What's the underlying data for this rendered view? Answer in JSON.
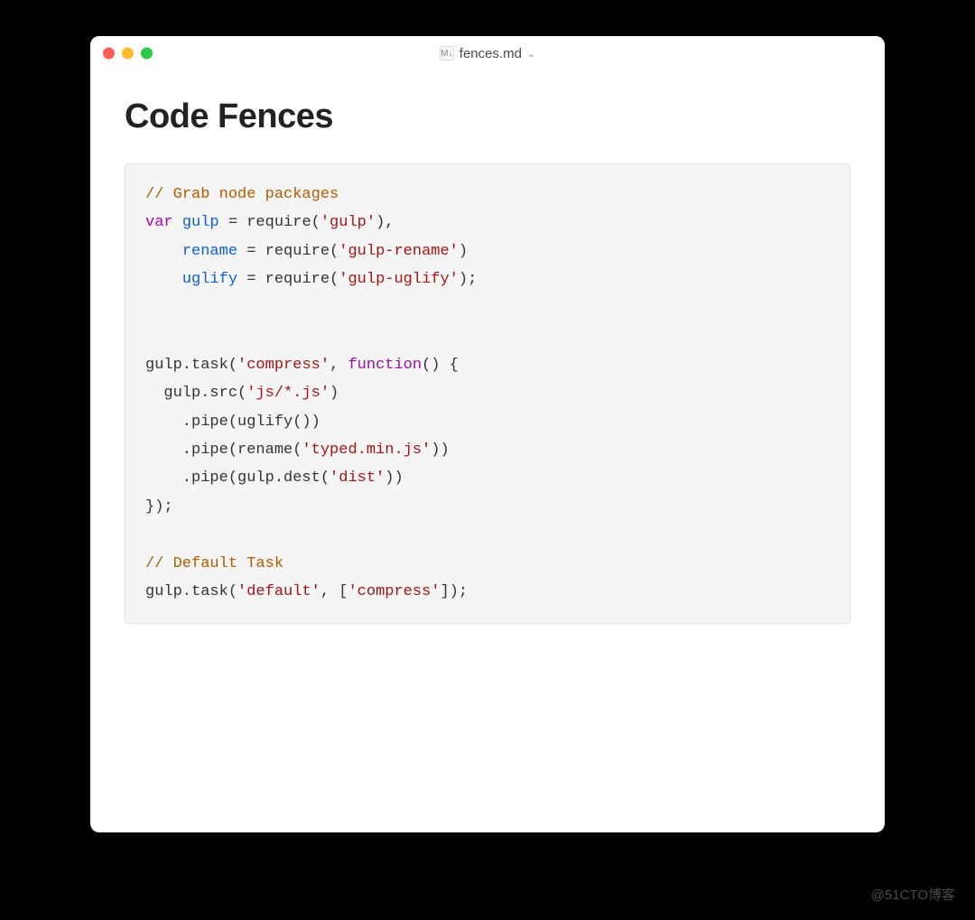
{
  "window": {
    "title": "fences.md",
    "icon_label": "M↓"
  },
  "document": {
    "heading": "Code Fences",
    "code": {
      "lines": [
        {
          "type": "comment",
          "text": "// Grab node packages"
        },
        {
          "type": "decl",
          "keyword": "var",
          "name": "gulp",
          "eq": " = ",
          "call": "require(",
          "str": "'gulp'",
          "end": "),"
        },
        {
          "type": "decl",
          "indent": "    ",
          "name": "rename",
          "eq": " = ",
          "call": "require(",
          "str": "'gulp-rename'",
          "end": ")"
        },
        {
          "type": "decl",
          "indent": "    ",
          "name": "uglify",
          "eq": " = ",
          "call": "require(",
          "str": "'gulp-uglify'",
          "end": ");"
        },
        {
          "type": "blank"
        },
        {
          "type": "blank"
        },
        {
          "type": "raw",
          "pre": "gulp.task(",
          "str": "'compress'",
          "mid": ", ",
          "kw": "function",
          "post": "() {"
        },
        {
          "type": "raw",
          "pre": "  gulp.src(",
          "str": "'js/*.js'",
          "post": ")"
        },
        {
          "type": "plain",
          "text": "    .pipe(uglify())"
        },
        {
          "type": "raw",
          "pre": "    .pipe(rename(",
          "str": "'typed.min.js'",
          "post": "))"
        },
        {
          "type": "raw",
          "pre": "    .pipe(gulp.dest(",
          "str": "'dist'",
          "post": "))"
        },
        {
          "type": "plain",
          "text": "});"
        },
        {
          "type": "blank"
        },
        {
          "type": "comment",
          "text": "// Default Task"
        },
        {
          "type": "raw",
          "pre": "gulp.task(",
          "str": "'default'",
          "mid": ", [",
          "str2": "'compress'",
          "post": "]);"
        }
      ]
    }
  },
  "watermark": "@51CTO博客"
}
